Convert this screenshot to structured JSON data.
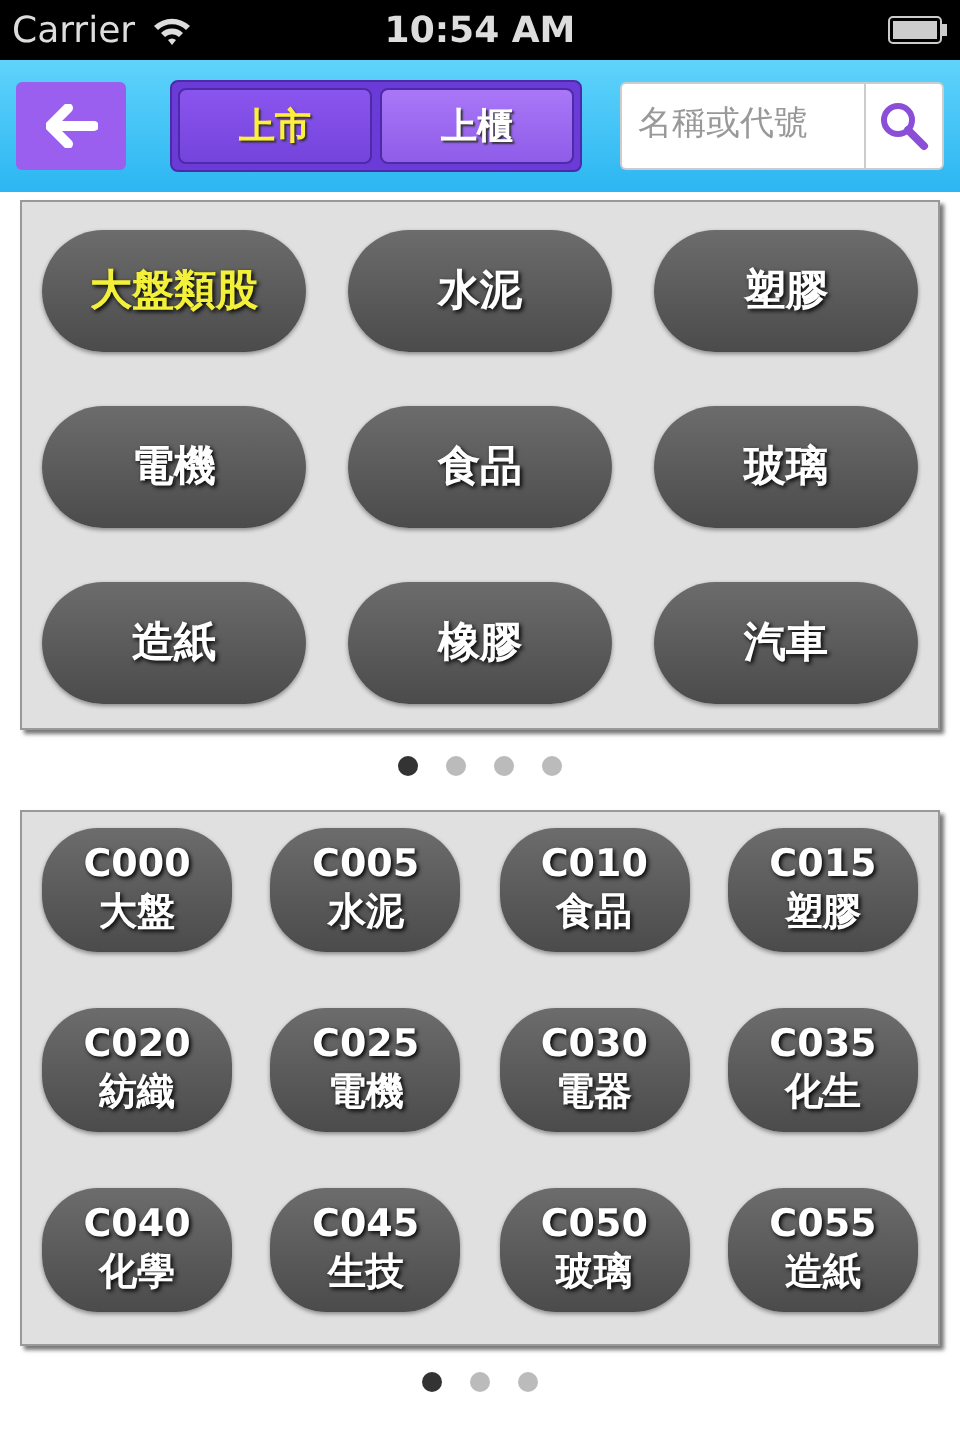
{
  "status_bar": {
    "carrier": "Carrier",
    "time": "10:54 AM"
  },
  "header": {
    "tabs": [
      {
        "label": "上市",
        "selected": true
      },
      {
        "label": "上櫃",
        "selected": false
      }
    ],
    "search": {
      "placeholder": "名稱或代號"
    }
  },
  "categories": {
    "items": [
      {
        "label": "大盤類股",
        "selected": true
      },
      {
        "label": "水泥",
        "selected": false
      },
      {
        "label": "塑膠",
        "selected": false
      },
      {
        "label": "電機",
        "selected": false
      },
      {
        "label": "食品",
        "selected": false
      },
      {
        "label": "玻璃",
        "selected": false
      },
      {
        "label": "造紙",
        "selected": false
      },
      {
        "label": "橡膠",
        "selected": false
      },
      {
        "label": "汽車",
        "selected": false
      }
    ],
    "pages": [
      {
        "selected": true
      },
      {
        "selected": false
      },
      {
        "selected": false
      },
      {
        "selected": false
      }
    ]
  },
  "indices": {
    "items": [
      {
        "code": "C000",
        "name": "大盤"
      },
      {
        "code": "C005",
        "name": "水泥"
      },
      {
        "code": "C010",
        "name": "食品"
      },
      {
        "code": "C015",
        "name": "塑膠"
      },
      {
        "code": "C020",
        "name": "紡織"
      },
      {
        "code": "C025",
        "name": "電機"
      },
      {
        "code": "C030",
        "name": "電器"
      },
      {
        "code": "C035",
        "name": "化生"
      },
      {
        "code": "C040",
        "name": "化學"
      },
      {
        "code": "C045",
        "name": "生技"
      },
      {
        "code": "C050",
        "name": "玻璃"
      },
      {
        "code": "C055",
        "name": "造紙"
      }
    ],
    "pages": [
      {
        "selected": true
      },
      {
        "selected": false
      },
      {
        "selected": false
      }
    ]
  }
}
